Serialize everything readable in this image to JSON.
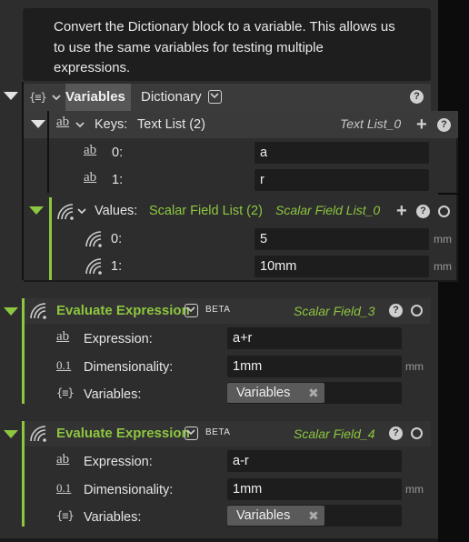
{
  "comment": {
    "text": "Convert the Dictionary block to a variable. This allows us to use the same variables for testing multiple expressions."
  },
  "dict_node": {
    "tab_variables": "Variables",
    "tab_dictionary": "Dictionary",
    "keys": {
      "label": "Keys:",
      "type": "Text List (2)",
      "name": "Text List_0",
      "items": [
        {
          "index": "0:",
          "value": "a"
        },
        {
          "index": "1:",
          "value": "r"
        }
      ]
    },
    "values": {
      "label": "Values:",
      "type": "Scalar Field List (2)",
      "name": "Scalar Field List_0",
      "items": [
        {
          "index": "0:",
          "value": "5",
          "unit": "mm"
        },
        {
          "index": "1:",
          "value": "10mm",
          "unit": "mm"
        }
      ]
    }
  },
  "eval_nodes": [
    {
      "title": "Evaluate Expression",
      "badge": "BETA",
      "name": "Scalar Field_3",
      "expression_label": "Expression:",
      "expression": "a+r",
      "dimensionality_label": "Dimensionality:",
      "dimensionality": "1mm",
      "dimensionality_unit": "mm",
      "variables_label": "Variables:",
      "variables_chip": "Variables"
    },
    {
      "title": "Evaluate Expression",
      "badge": "BETA",
      "name": "Scalar Field_4",
      "expression_label": "Expression:",
      "expression": "a-r",
      "dimensionality_label": "Dimensionality:",
      "dimensionality": "1mm",
      "dimensionality_unit": "mm",
      "variables_label": "Variables:",
      "variables_chip": "Variables"
    }
  ],
  "icons": {
    "text_type": "ab",
    "number_type": "0.1",
    "dict_type": "{≡}"
  },
  "colors": {
    "accent_green": "#8dc63f",
    "panel": "#2d2d2d",
    "field": "#1d1d1d"
  }
}
